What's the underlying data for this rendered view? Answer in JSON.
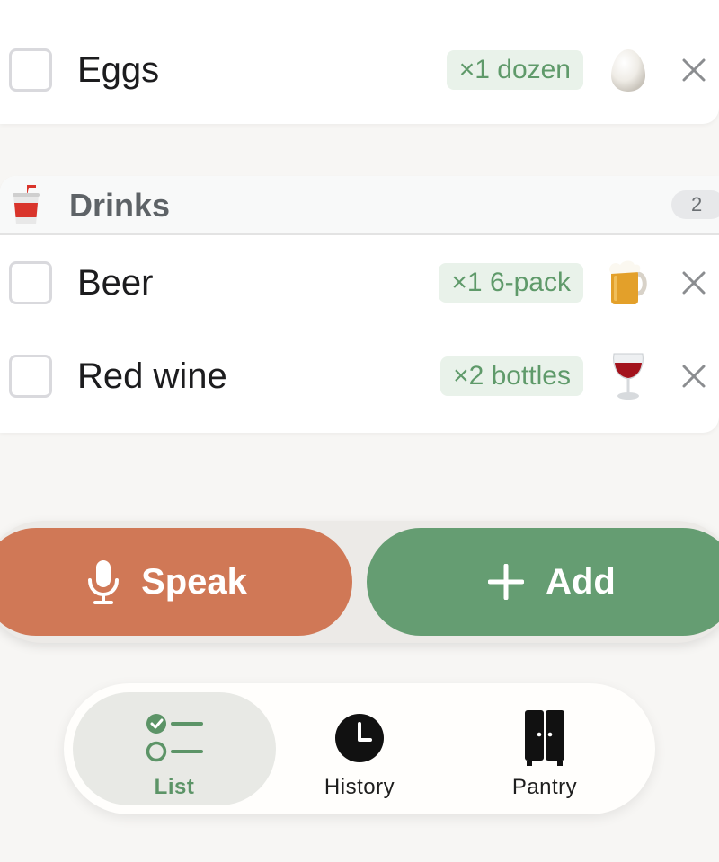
{
  "dairy_section": {
    "items": [
      {
        "name": "Eggs",
        "quantity": "×1 dozen",
        "emoji": "egg"
      }
    ]
  },
  "drinks_section": {
    "title": "Drinks",
    "count": "2",
    "icon": "cup-with-straw-icon",
    "items": [
      {
        "name": "Beer",
        "quantity": "×1 6-pack",
        "emoji": "beer-mug"
      },
      {
        "name": "Red wine",
        "quantity": "×2 bottles",
        "emoji": "wine-glass"
      }
    ]
  },
  "actions": {
    "speak_label": "Speak",
    "add_label": "Add"
  },
  "tabs": [
    {
      "label": "List",
      "active": true
    },
    {
      "label": "History",
      "active": false
    },
    {
      "label": "Pantry",
      "active": false
    }
  ],
  "colors": {
    "speak": "#d07856",
    "add": "#659d72",
    "quantity_text": "#5f9a6a",
    "quantity_bg": "#e9f2ea",
    "active_tab_text": "#5c9467"
  }
}
